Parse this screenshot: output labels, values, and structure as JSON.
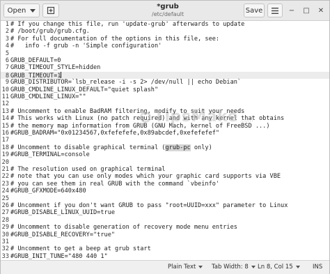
{
  "header": {
    "open_label": "Open",
    "title": "*grub",
    "subtitle": "/etc/default",
    "save_label": "Save",
    "minimize_glyph": "−",
    "maximize_glyph": "□",
    "close_glyph": "✕"
  },
  "editor": {
    "lines": [
      {
        "num": "1",
        "text": "# If you change this file, run 'update-grub' afterwards to update"
      },
      {
        "num": "2",
        "text": "# /boot/grub/grub.cfg."
      },
      {
        "num": "3",
        "text": "# For full documentation of the options in this file, see:"
      },
      {
        "num": "4",
        "text": "#   info -f grub -n 'Simple configuration'"
      },
      {
        "num": "5",
        "text": ""
      },
      {
        "num": "6",
        "text": "GRUB_DEFAULT=0"
      },
      {
        "num": "7",
        "text": "GRUB_TIMEOUT_STYLE=hidden"
      },
      {
        "num": "8",
        "text": "GRUB_TIMEOUT=1"
      },
      {
        "num": "9",
        "text": "GRUB_DISTRIBUTOR=`lsb_release -i -s 2> /dev/null || echo Debian`"
      },
      {
        "num": "10",
        "text": "GRUB_CMDLINE_LINUX_DEFAULT=\"quiet splash\""
      },
      {
        "num": "11",
        "text": "GRUB_CMDLINE_LINUX=\"\""
      },
      {
        "num": "12",
        "text": ""
      },
      {
        "num": "13",
        "text": "# Uncomment to enable BadRAM filtering, modify to suit your needs"
      },
      {
        "num": "14",
        "text": "# This works with Linux (no patch required) and with any kernel that obtains"
      },
      {
        "num": "15",
        "text": "# the memory map information from GRUB (GNU Mach, kernel of FreeBSD ...)"
      },
      {
        "num": "16",
        "text": "#GRUB_BADRAM=\"0x01234567,0xfefefefe,0x89abcdef,0xefefefef\""
      },
      {
        "num": "17",
        "text": ""
      },
      {
        "num": "18",
        "text": "# Uncomment to disable graphical terminal (grub-pc only)"
      },
      {
        "num": "19",
        "text": "#GRUB_TERMINAL=console"
      },
      {
        "num": "20",
        "text": ""
      },
      {
        "num": "21",
        "text": "# The resolution used on graphical terminal"
      },
      {
        "num": "22",
        "text": "# note that you can use only modes which your graphic card supports via VBE"
      },
      {
        "num": "23",
        "text": "# you can see them in real GRUB with the command `vbeinfo'"
      },
      {
        "num": "24",
        "text": "#GRUB_GFXMODE=640x480"
      },
      {
        "num": "25",
        "text": ""
      },
      {
        "num": "26",
        "text": "# Uncomment if you don't want GRUB to pass \"root=UUID=xxx\" parameter to Linux"
      },
      {
        "num": "27",
        "text": "#GRUB_DISABLE_LINUX_UUID=true"
      },
      {
        "num": "28",
        "text": ""
      },
      {
        "num": "29",
        "text": "# Uncomment to disable generation of recovery mode menu entries"
      },
      {
        "num": "30",
        "text": "#GRUB_DISABLE_RECOVERY=\"true\""
      },
      {
        "num": "31",
        "text": ""
      },
      {
        "num": "32",
        "text": "# Uncomment to get a beep at grub start"
      },
      {
        "num": "33",
        "text": "#GRUB_INIT_TUNE=\"480 440 1\""
      }
    ],
    "current_line": 8,
    "selection": {
      "line": 18,
      "text": "grub-pc"
    }
  },
  "watermark": {
    "text": "TipsMake",
    "tld": ".com"
  },
  "statusbar": {
    "language": "Plain Text",
    "tab_width": "Tab Width: 8",
    "position": "Ln 8, Col 15",
    "mode": "INS"
  },
  "colors": {
    "titlebar": "#e9e9e9",
    "current_line": "#ececec",
    "selection": "#d6d6d6",
    "statusbar": "#f0f0f0"
  }
}
